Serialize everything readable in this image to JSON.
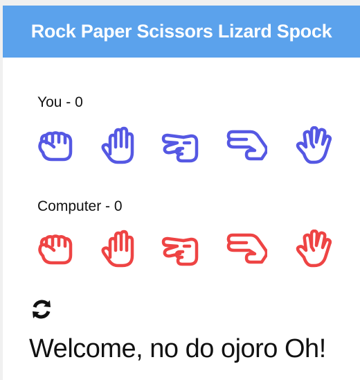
{
  "app": {
    "title": "Rock Paper Scissors Lizard Spock"
  },
  "player": {
    "label": "You - 0"
  },
  "computer": {
    "label": "Computer - 0"
  },
  "hands": [
    {
      "name": "rock",
      "icon": "hand-rock-icon"
    },
    {
      "name": "paper",
      "icon": "hand-paper-icon"
    },
    {
      "name": "scissors",
      "icon": "hand-scissors-icon"
    },
    {
      "name": "lizard",
      "icon": "hand-lizard-icon"
    },
    {
      "name": "spock",
      "icon": "hand-spock-icon"
    }
  ],
  "colors": {
    "header": "#5ba2ec",
    "player": "#5558e3",
    "computer": "#ee4444"
  },
  "reset": {
    "icon": "refresh-icon"
  },
  "status": {
    "message": "Welcome, no do ojoro Oh!"
  }
}
